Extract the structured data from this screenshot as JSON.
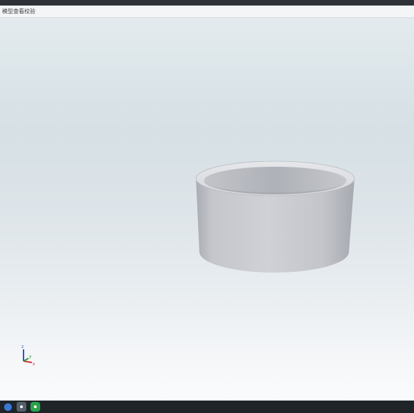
{
  "window": {
    "title": "模型查看校验"
  },
  "viewport": {
    "model": "hollow-cylinder-ring",
    "colors": {
      "model_outer": "#c9cbd1",
      "model_inner": "#b6b9bf",
      "axis_x": "#d12f2f",
      "axis_y": "#2f9a3a",
      "axis_z": "#2f4fd1"
    }
  },
  "axes": {
    "x_label": "x",
    "y_label": "y",
    "z_label": "z"
  },
  "taskbar": {
    "items": [
      "start",
      "file-explorer",
      "wechat"
    ]
  }
}
